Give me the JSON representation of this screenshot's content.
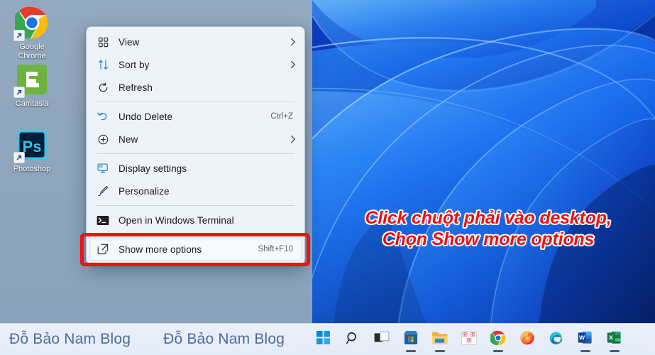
{
  "desktop": {
    "icons": [
      {
        "label": "Google\nChrome",
        "name": "google-chrome",
        "icon": "chrome-icon"
      },
      {
        "label": "Camtasia",
        "name": "camtasia",
        "icon": "camtasia-icon"
      },
      {
        "label": "Photoshop",
        "name": "photoshop",
        "icon": "photoshop-icon"
      }
    ],
    "wallpaper_name": "windows-11-bloom-wallpaper",
    "colors": {
      "wallpaper_blue": "#0b3ccf",
      "wallpaper_light": "#4aa8f7",
      "dim_left": "#8fa6bd"
    }
  },
  "context_menu": {
    "items": [
      {
        "label": "View",
        "icon": "view-grid-icon",
        "accel": "",
        "chevron": true,
        "highlighted": false,
        "separator_after": false
      },
      {
        "label": "Sort by",
        "icon": "sort-arrows-icon",
        "accel": "",
        "chevron": true,
        "highlighted": false,
        "separator_after": false
      },
      {
        "label": "Refresh",
        "icon": "refresh-icon",
        "accel": "",
        "chevron": false,
        "highlighted": false,
        "separator_after": true
      },
      {
        "label": "Undo Delete",
        "icon": "undo-icon",
        "accel": "Ctrl+Z",
        "chevron": false,
        "highlighted": false,
        "separator_after": false
      },
      {
        "label": "New",
        "icon": "plus-circle-icon",
        "accel": "",
        "chevron": true,
        "highlighted": false,
        "separator_after": true
      },
      {
        "label": "Display settings",
        "icon": "display-settings-icon",
        "accel": "",
        "chevron": false,
        "highlighted": false,
        "separator_after": false
      },
      {
        "label": "Personalize",
        "icon": "personalize-brush-icon",
        "accel": "",
        "chevron": false,
        "highlighted": false,
        "separator_after": true
      },
      {
        "label": "Open in Windows Terminal",
        "icon": "terminal-icon",
        "accel": "",
        "chevron": false,
        "highlighted": false,
        "separator_after": true
      },
      {
        "label": "Show more options",
        "icon": "show-more-options-icon",
        "accel": "Shift+F10",
        "chevron": false,
        "highlighted": true,
        "separator_after": false
      }
    ]
  },
  "annotation": {
    "line1": "Click chuột phải vào desktop,",
    "line2": "Chọn Show more options",
    "color": "#ee1111",
    "outline_color": "#ffffff",
    "highlight_box_color": "#ee1212"
  },
  "taskbar": {
    "brand_left": "Đỗ Bảo Nam Blog",
    "brand_right": "Đỗ Bảo Nam Blog",
    "brand_color": "#4f6c99",
    "background": "#e8eef8",
    "icons": [
      {
        "name": "start-icon",
        "label": "Start",
        "running": false
      },
      {
        "name": "search-icon",
        "label": "Search",
        "running": false
      },
      {
        "name": "task-view-icon",
        "label": "Task View",
        "running": false
      },
      {
        "name": "microsoft-store-icon",
        "label": "Microsoft Store",
        "running": true
      },
      {
        "name": "file-explorer-icon",
        "label": "File Explorer",
        "running": true
      },
      {
        "name": "unikey-icon",
        "label": "Unikey",
        "running": false
      },
      {
        "name": "chrome-icon",
        "label": "Google Chrome",
        "running": true
      },
      {
        "name": "firefox-icon",
        "label": "Firefox",
        "running": false
      },
      {
        "name": "edge-icon",
        "label": "Microsoft Edge",
        "running": false
      },
      {
        "name": "word-icon",
        "label": "Word",
        "running": true
      },
      {
        "name": "excel-icon",
        "label": "Excel",
        "running": true
      }
    ]
  }
}
